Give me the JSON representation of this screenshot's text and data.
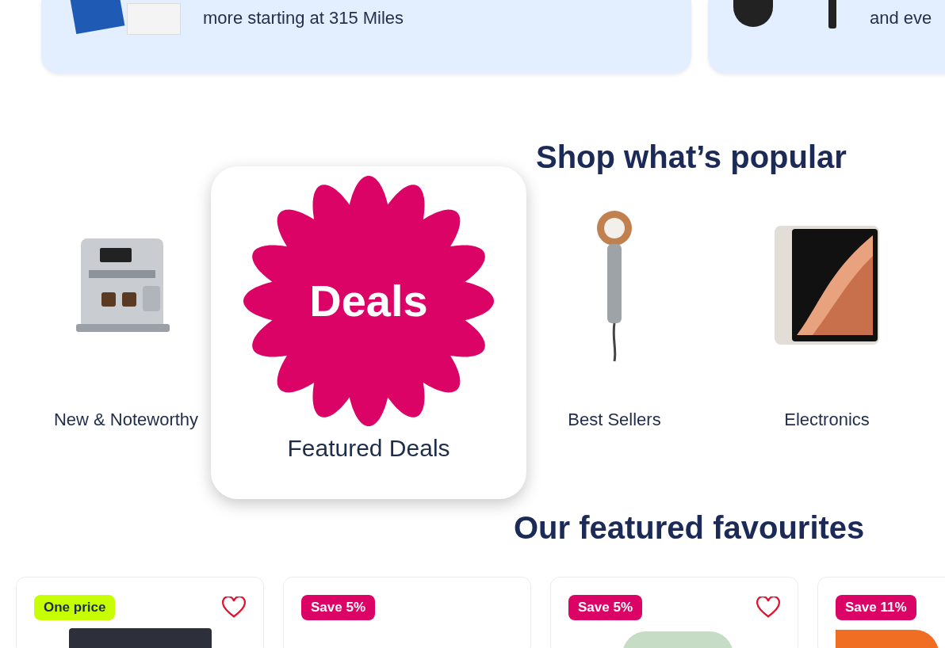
{
  "banners": [
    {
      "text": "more starting at 315 Miles"
    },
    {
      "text": "and eve"
    }
  ],
  "popular": {
    "heading": "Shop what’s popular",
    "categories": [
      {
        "kind": "espresso",
        "label": "New & Noteworthy",
        "selected": false
      },
      {
        "kind": "deals",
        "label": "Featured Deals",
        "badge": "Deals",
        "selected": true
      },
      {
        "kind": "dryer",
        "label": "Best Sellers",
        "selected": false
      },
      {
        "kind": "tablet",
        "label": "Electronics",
        "selected": false
      }
    ]
  },
  "featured": {
    "heading": "Our featured favourites",
    "products": [
      {
        "kind": "screen",
        "badge": {
          "text": "One price",
          "kind": "one_price"
        },
        "heart": true
      },
      {
        "kind": "blank",
        "badge": {
          "text": "Save 5%",
          "kind": "save"
        },
        "heart": false
      },
      {
        "kind": "appliance",
        "badge": {
          "text": "Save 5%",
          "kind": "save"
        },
        "heart": true
      },
      {
        "kind": "orange",
        "badge": {
          "text": "Save 11%",
          "kind": "save"
        },
        "heart": false
      }
    ]
  }
}
